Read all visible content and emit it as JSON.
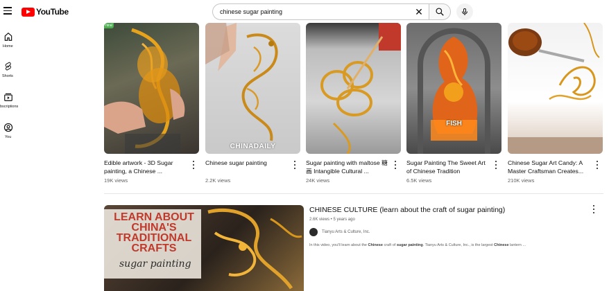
{
  "header": {
    "logo_text": "YouTube",
    "search_value": "chinese sugar painting",
    "icons": {
      "menu": "menu-icon",
      "clear": "close-icon",
      "search": "search-icon",
      "mic": "mic-icon"
    }
  },
  "sidebar": {
    "items": [
      {
        "label": "Home",
        "icon": "home-icon"
      },
      {
        "label": "Shorts",
        "icon": "shorts-icon"
      },
      {
        "label": "bscriptions",
        "icon": "subscriptions-icon"
      },
      {
        "label": "You",
        "icon": "you-icon"
      }
    ]
  },
  "shorts": [
    {
      "title": "Edible artwork - 3D Sugar painting, a Chinese ...",
      "views": "19K views",
      "badge": "ntral"
    },
    {
      "title": "Chinese sugar painting",
      "views": "2.2K views",
      "overlay": "CHINADAILY"
    },
    {
      "title": "Sugar painting with maltose 糖画 Intangible Cultural ...",
      "views": "24K views"
    },
    {
      "title": "Sugar Painting The Sweet Art of Chinese Tradition",
      "views": "6.5K views",
      "overlay": "FISH"
    },
    {
      "title": "Chinese Sugar Art Candy: A Master Craftsman Creates...",
      "views": "210K views"
    }
  ],
  "video": {
    "title": "CHINESE CULTURE (learn about the craft of sugar painting)",
    "meta": "2.6K views • 5 years ago",
    "channel": "Tianyu Arts & Culture, Inc.",
    "desc_parts": [
      "In this video, you'll learn about the ",
      "Chinese",
      " craft of ",
      "sugar painting",
      ". Tianyu Arts & Culture, Inc., is the largest ",
      "Chinese",
      " lantern ..."
    ],
    "thumb_text": [
      "LEARN ABOUT",
      "CHINA'S",
      "TRADITIONAL",
      "CRAFTS"
    ],
    "thumb_script": "sugar painting"
  },
  "colors": {
    "brand_red": "#ff0000",
    "text_primary": "#0f0f0f",
    "text_secondary": "#606060",
    "thumb_red": "#c0392b"
  }
}
